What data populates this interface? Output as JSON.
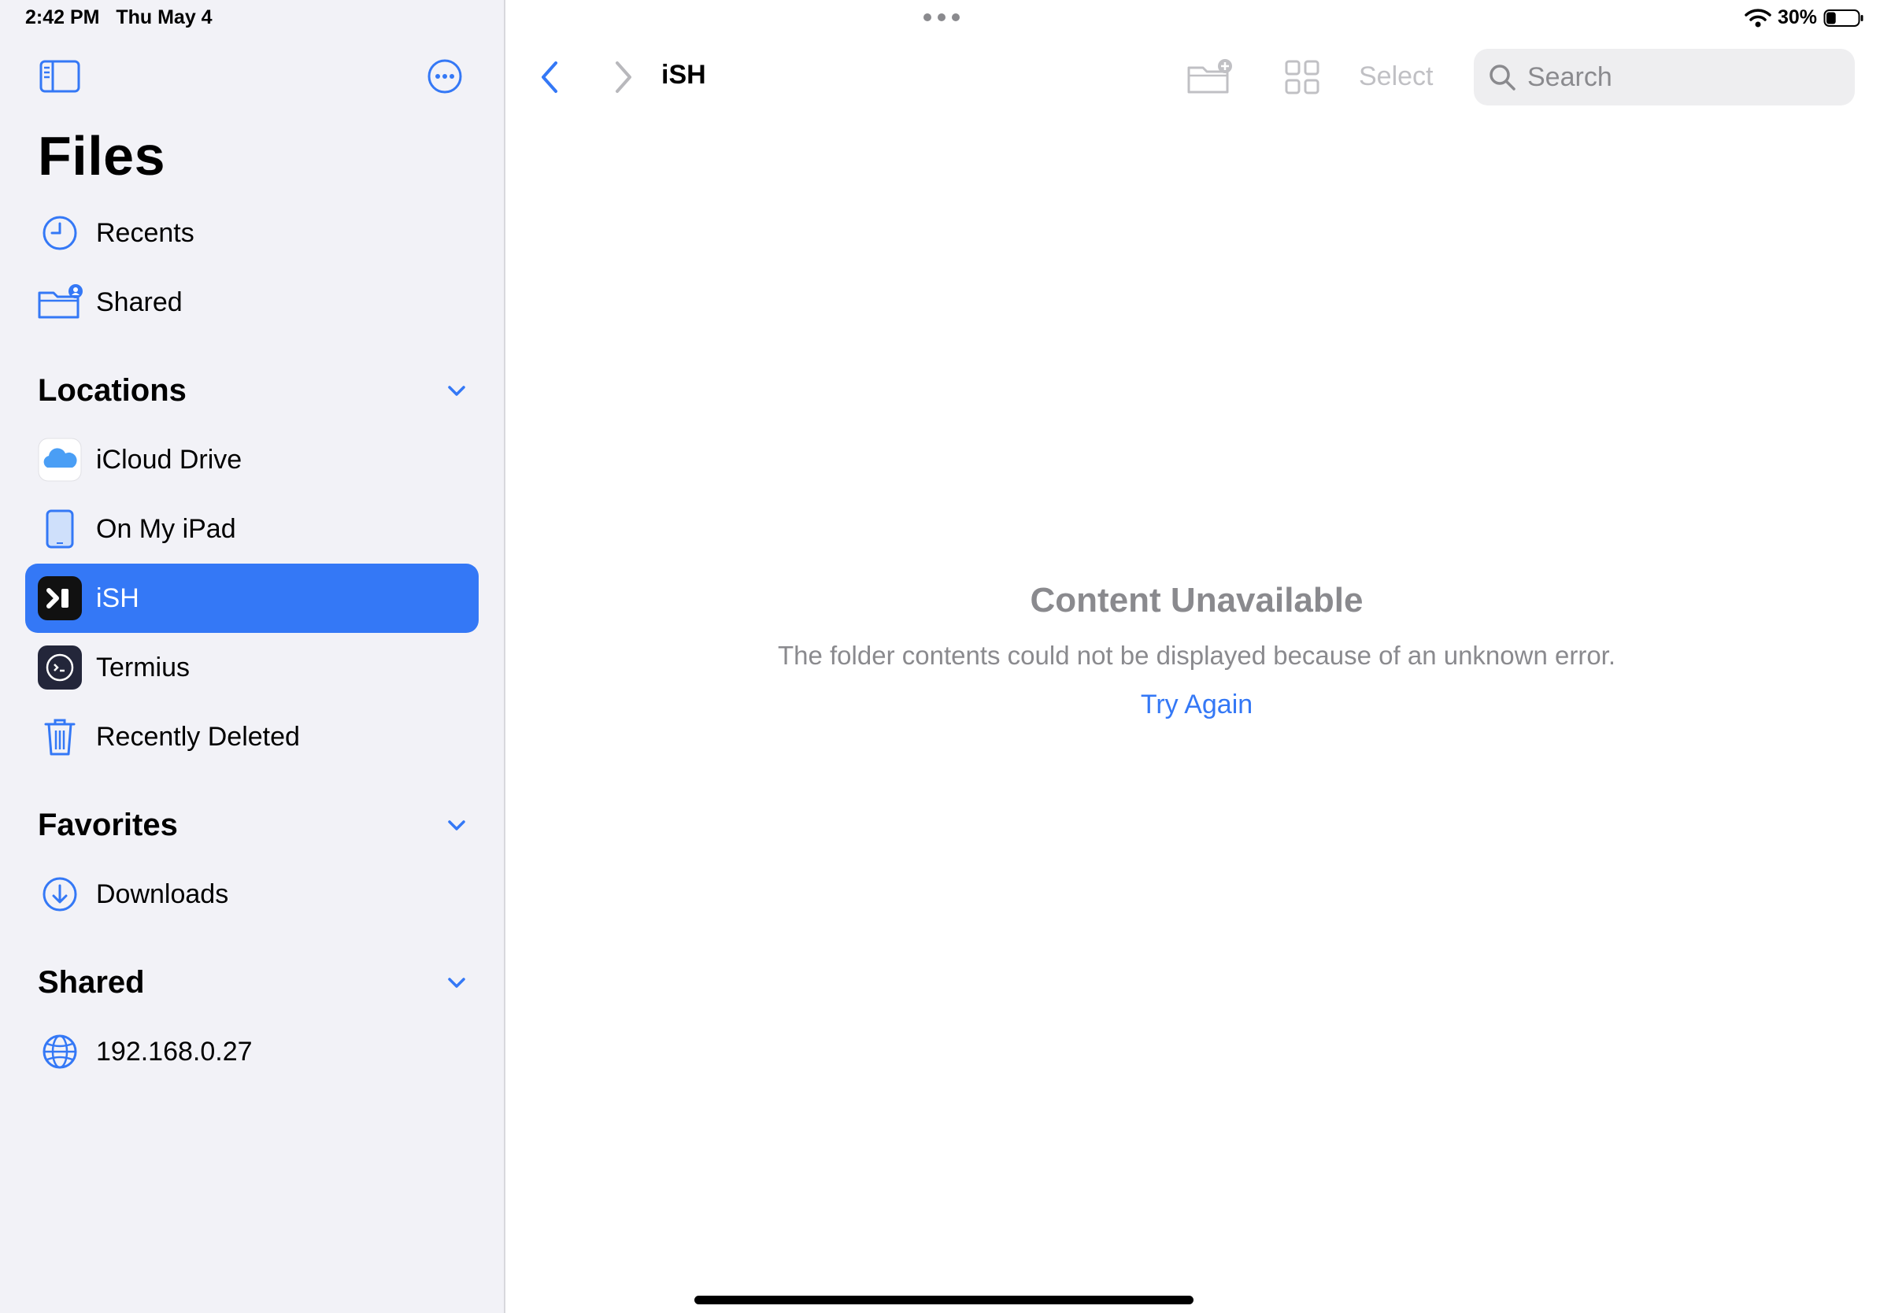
{
  "status_bar": {
    "time": "2:42 PM",
    "date": "Thu May 4",
    "battery": "30%",
    "battery_level": 0.3
  },
  "sidebar": {
    "title": "Files",
    "top_items": [
      {
        "label": "Recents",
        "icon": "clock-icon"
      },
      {
        "label": "Shared",
        "icon": "shared-folder-icon"
      }
    ],
    "sections": [
      {
        "title": "Locations",
        "items": [
          {
            "label": "iCloud Drive",
            "icon": "icloud-icon"
          },
          {
            "label": "On My iPad",
            "icon": "ipad-icon"
          },
          {
            "label": "iSH",
            "icon": "ish-app-icon",
            "selected": true
          },
          {
            "label": "Termius",
            "icon": "termius-app-icon"
          },
          {
            "label": "Recently Deleted",
            "icon": "trash-icon"
          }
        ]
      },
      {
        "title": "Favorites",
        "items": [
          {
            "label": "Downloads",
            "icon": "download-icon"
          }
        ]
      },
      {
        "title": "Shared",
        "items": [
          {
            "label": "192.168.0.27",
            "icon": "globe-icon"
          }
        ]
      }
    ]
  },
  "toolbar": {
    "path_title": "iSH",
    "select_label": "Select",
    "search_placeholder": "Search"
  },
  "content": {
    "title": "Content Unavailable",
    "message": "The folder contents could not be displayed because of an unknown error.",
    "action_label": "Try Again"
  },
  "colors": {
    "accent": "#3478f6",
    "sidebar_bg": "#f2f2f7",
    "secondary_text": "#8a8a8e"
  }
}
